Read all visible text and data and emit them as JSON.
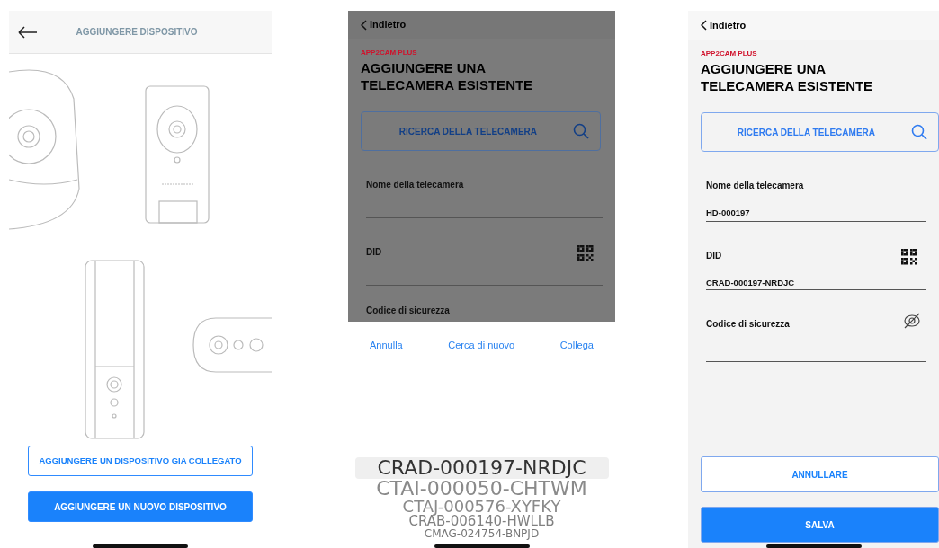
{
  "add_device_screen": {
    "title": "AGGIUNGERE DISPOSITIVO",
    "buttons": [
      {
        "label": "AGGIUNGERE UN DISPOSITIVO GIA COLLEGATO",
        "primary": false
      },
      {
        "label": "AGGIUNGERE UN NUOVO DISPOSITIVO",
        "primary": true
      }
    ]
  },
  "picker_screen": {
    "dimmed": true,
    "back": "Indietro",
    "brand": "APP2CAM PLUS",
    "title": "AGGIUNGERE UNA TELECAMERA ESISTENTE",
    "search_button": "RICERCA DELLA TELECAMERA",
    "fields": [
      {
        "kind": "text",
        "label": "Nome della telecamera"
      },
      {
        "kind": "qr",
        "label": "DID"
      },
      {
        "kind": "cut",
        "label": "Codice di sicurezza"
      }
    ],
    "actions": [
      "Annulla",
      "Cerca di nuovo",
      "Collega"
    ],
    "options": [
      {
        "label": "CRAD-000197-NRDJC",
        "selected": true
      },
      {
        "label": "CTAI-000050-CHTWM",
        "selected": false
      },
      {
        "label": "CTAJ-000576-XYFKY",
        "selected": false
      },
      {
        "label": "CRAB-006140-HWLLB",
        "selected": false
      },
      {
        "label": "CMAG-024754-BNPJD",
        "selected": false
      }
    ]
  },
  "form_screen": {
    "back": "Indietro",
    "brand": "APP2CAM PLUS",
    "title": "AGGIUNGERE UNA TELECAMERA ESISTENTE",
    "search_button": "RICERCA DELLA TELECAMERA",
    "fields": [
      {
        "kind": "text",
        "label": "Nome della telecamera",
        "value": "HD-000197"
      },
      {
        "kind": "qr",
        "label": "DID",
        "value": "CRAD-000197-NRDJC"
      },
      {
        "kind": "password",
        "label": "Codice di sicurezza"
      }
    ],
    "buttons": [
      {
        "label": "ANNULLARE",
        "primary": false
      },
      {
        "label": "SALVA",
        "primary": true
      }
    ]
  }
}
